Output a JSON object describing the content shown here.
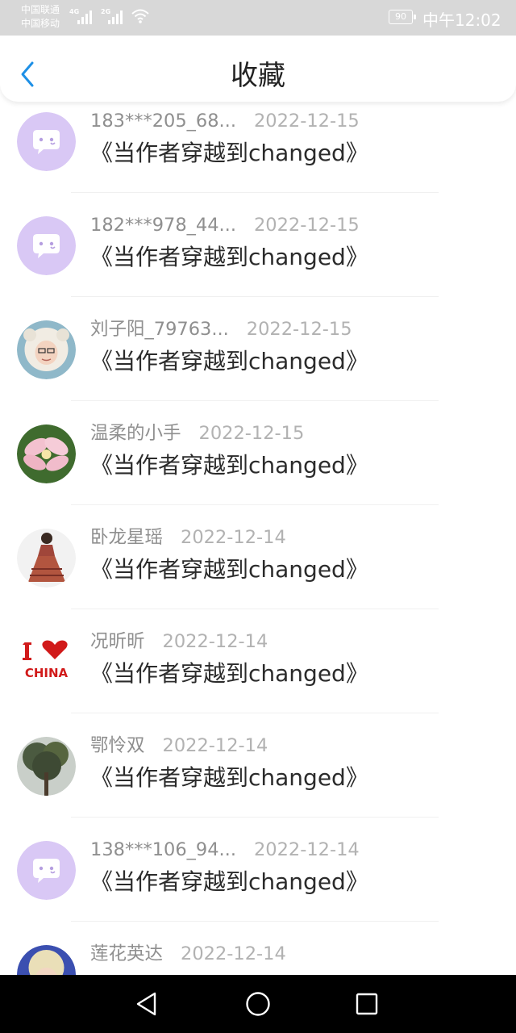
{
  "status_bar": {
    "carrier1": "中国联通",
    "carrier2": "中国移动",
    "net1": "4G",
    "net2": "2G",
    "battery": "90",
    "time": "中午12:02"
  },
  "header": {
    "title": "收藏"
  },
  "items": [
    {
      "username": "183***205_68...",
      "date": "2022-12-15",
      "title": "《当作者穿越到changed》",
      "avatar": "chat-bubble-avatar"
    },
    {
      "username": "182***978_44...",
      "date": "2022-12-15",
      "title": "《当作者穿越到changed》",
      "avatar": "chat-bubble-avatar"
    },
    {
      "username": "刘子阳_79763...",
      "date": "2022-12-15",
      "title": "《当作者穿越到changed》",
      "avatar": "sheep-costume-photo-avatar"
    },
    {
      "username": "温柔的小手",
      "date": "2022-12-15",
      "title": "《当作者穿越到changed》",
      "avatar": "pink-flower-photo-avatar"
    },
    {
      "username": "卧龙星瑶",
      "date": "2022-12-14",
      "title": "《当作者穿越到changed》",
      "avatar": "girl-dress-photo-avatar"
    },
    {
      "username": "况昕昕",
      "date": "2022-12-14",
      "title": "《当作者穿越到changed》",
      "avatar": "i-love-china-avatar"
    },
    {
      "username": "鄂怜双",
      "date": "2022-12-14",
      "title": "《当作者穿越到changed》",
      "avatar": "tree-photo-avatar"
    },
    {
      "username": "138***106_94...",
      "date": "2022-12-14",
      "title": "《当作者穿越到changed》",
      "avatar": "chat-bubble-avatar"
    },
    {
      "username": "莲花英达",
      "date": "2022-12-14",
      "title": "",
      "avatar": "blonde-person-photo-avatar"
    }
  ],
  "avatar_texts": {
    "china": "CHINA"
  },
  "colors": {
    "accent": "#1e90e6",
    "default_avatar_bg": "#d9c8f5"
  },
  "nav": {
    "back": "back-triangle-icon",
    "home": "home-circle-icon",
    "recent": "recent-square-icon"
  }
}
